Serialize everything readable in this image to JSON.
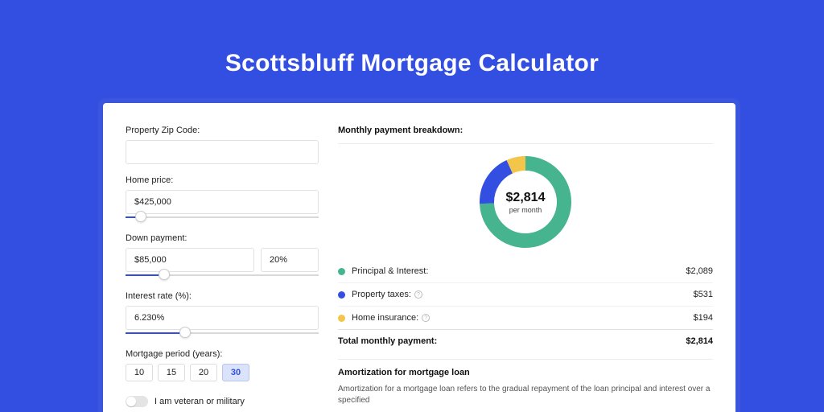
{
  "page_title": "Scottsbluff Mortgage Calculator",
  "colors": {
    "pi": "#45b48f",
    "tax": "#324fe1",
    "ins": "#f3c54a"
  },
  "form": {
    "zip_label": "Property Zip Code:",
    "zip_value": "",
    "price_label": "Home price:",
    "price_value": "$425,000",
    "price_slider_pct": 8,
    "down_label": "Down payment:",
    "down_value": "$85,000",
    "down_pct_value": "20%",
    "down_slider_pct": 20,
    "rate_label": "Interest rate (%):",
    "rate_value": "6.230%",
    "rate_slider_pct": 31,
    "period_label": "Mortgage period (years):",
    "periods": [
      "10",
      "15",
      "20",
      "30"
    ],
    "period_active": "30",
    "veteran_label": "I am veteran or military"
  },
  "breakdown": {
    "title": "Monthly payment breakdown:",
    "center_amount": "$2,814",
    "center_sub": "per month",
    "items": [
      {
        "label": "Principal & Interest:",
        "value": "$2,089",
        "color_key": "pi",
        "info": false
      },
      {
        "label": "Property taxes:",
        "value": "$531",
        "color_key": "tax",
        "info": true
      },
      {
        "label": "Home insurance:",
        "value": "$194",
        "color_key": "ins",
        "info": true
      }
    ],
    "total_label": "Total monthly payment:",
    "total_value": "$2,814"
  },
  "amort": {
    "title": "Amortization for mortgage loan",
    "body": "Amortization for a mortgage loan refers to the gradual repayment of the loan principal and interest over a specified"
  },
  "chart_data": {
    "type": "pie",
    "title": "Monthly payment breakdown",
    "series": [
      {
        "name": "Principal & Interest",
        "value": 2089,
        "color": "#45b48f"
      },
      {
        "name": "Property taxes",
        "value": 531,
        "color": "#324fe1"
      },
      {
        "name": "Home insurance",
        "value": 194,
        "color": "#f3c54a"
      }
    ],
    "total": 2814,
    "center_label": "$2,814 per month"
  }
}
